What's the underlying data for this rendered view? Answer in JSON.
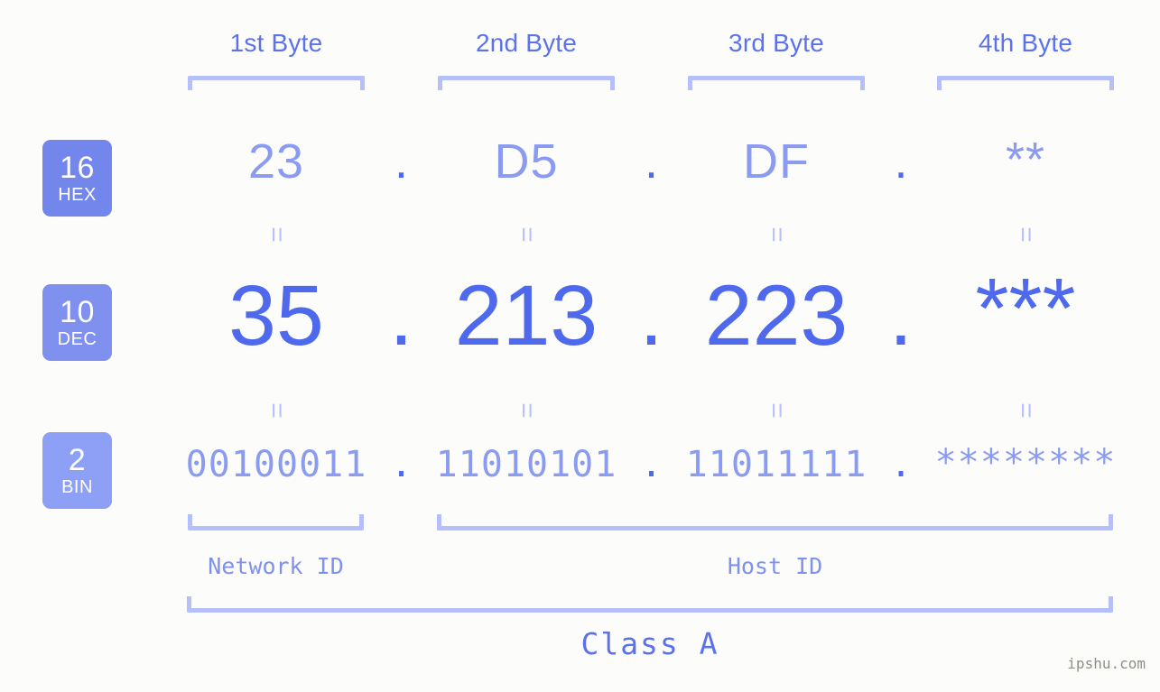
{
  "background_color": "#fcfdfa",
  "accent_color": "#4f69ed",
  "muted_accent_color": "#8b9cf0",
  "bracket_color": "#b5bffa",
  "headers": [
    {
      "label": "1st Byte"
    },
    {
      "label": "2nd Byte"
    },
    {
      "label": "3rd Byte"
    },
    {
      "label": "4th Byte"
    }
  ],
  "rows": [
    {
      "badge_number": "16",
      "badge_name": "HEX",
      "badge_color": "#7386ec",
      "values": [
        "23",
        "D5",
        "DF",
        "**"
      ],
      "separator": "."
    },
    {
      "badge_number": "10",
      "badge_name": "DEC",
      "badge_color": "#7f90ef",
      "values": [
        "35",
        "213",
        "223",
        "***"
      ],
      "separator": "."
    },
    {
      "badge_number": "2",
      "badge_name": "BIN",
      "badge_color": "#8da0f5",
      "values": [
        "00100011",
        "11010101",
        "11011111",
        "********"
      ],
      "separator": "."
    }
  ],
  "equality_mark": "=",
  "segments": {
    "network_id": "Network ID",
    "host_id": "Host ID"
  },
  "class_label": "Class A",
  "watermark": "ipshu.com"
}
